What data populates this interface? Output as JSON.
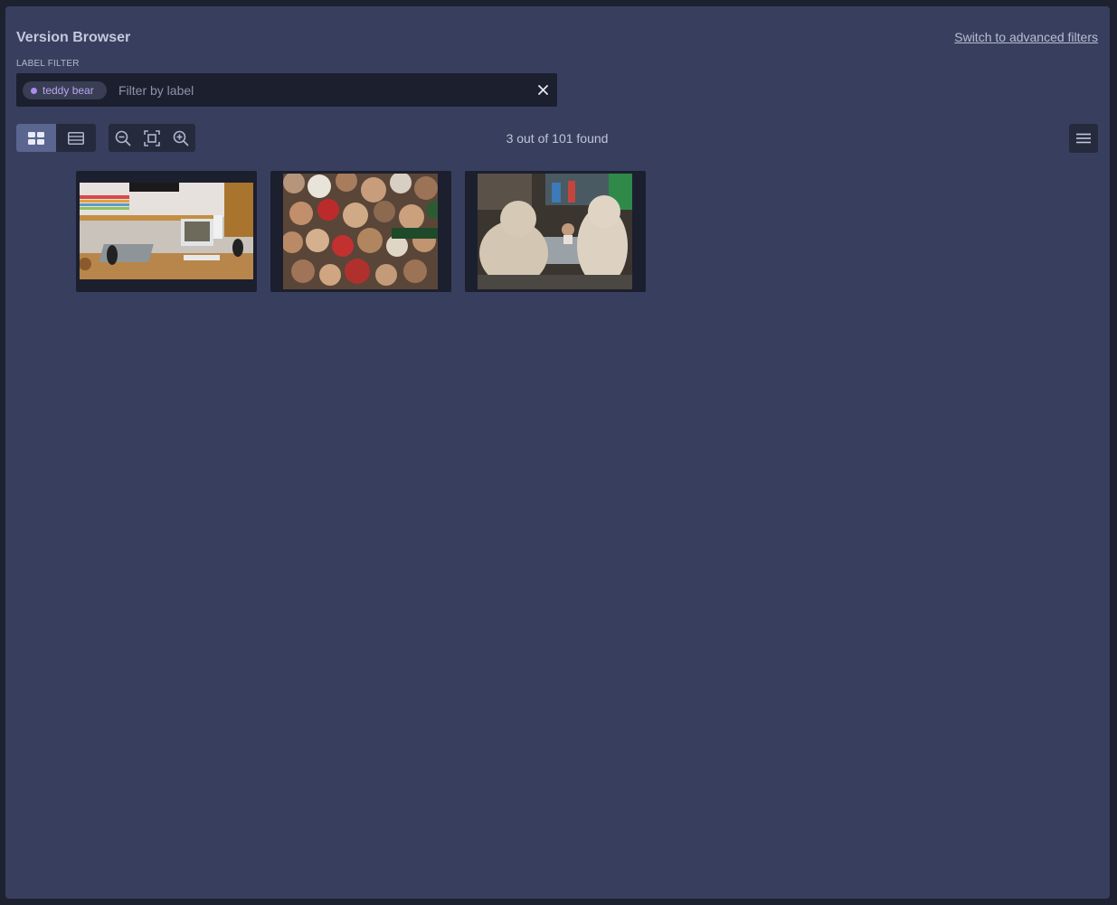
{
  "header": {
    "title": "Version Browser",
    "advanced_link": "Switch to advanced filters"
  },
  "filter": {
    "label": "LABEL FILTER",
    "chip_label": "teddy bear",
    "chip_color": "#a98cf0",
    "placeholder": "Filter by label",
    "value": "",
    "clear_icon": "close-icon"
  },
  "toolbar": {
    "view_buttons": [
      {
        "icon": "grid-view-icon",
        "active": true
      },
      {
        "icon": "list-view-icon",
        "active": false
      }
    ],
    "zoom_buttons": [
      {
        "icon": "zoom-out-icon"
      },
      {
        "icon": "fit-to-screen-icon"
      },
      {
        "icon": "zoom-in-icon"
      }
    ],
    "result_count": "3 out of 101 found",
    "menu_icon": "hamburger-menu-icon"
  },
  "results": [
    {
      "thumbnail": "desk with computer and teddy bear on shelf"
    },
    {
      "thumbnail": "pile of plush teddy bears"
    },
    {
      "thumbnail": "large teddy bears at a table in a store"
    }
  ],
  "colors": {
    "panel": "#383f5e",
    "background": "#1e2130",
    "accent": "#5a6590",
    "chip": "#a98cf0"
  }
}
